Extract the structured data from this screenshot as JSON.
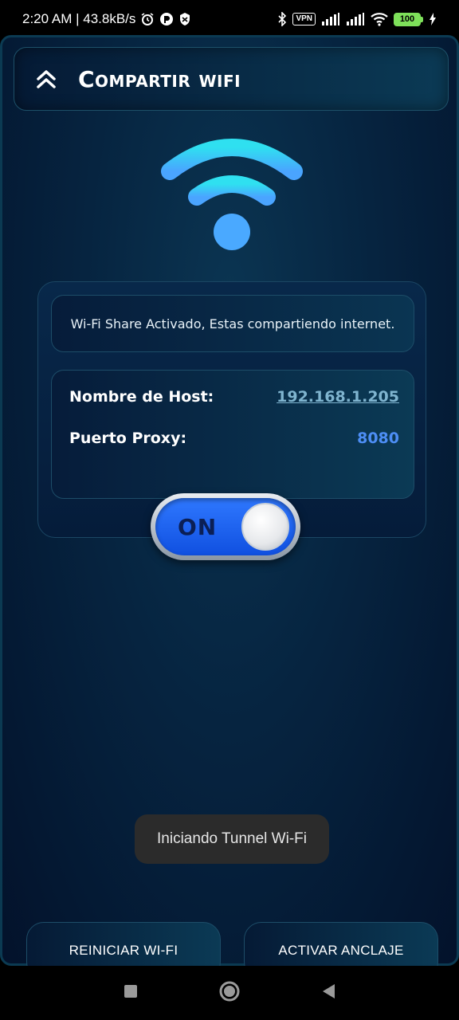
{
  "status_bar": {
    "time_speed": "2:20 AM | 43.8kB/s",
    "vpn_label": "VPN",
    "battery": "100"
  },
  "header": {
    "title": "Compartir wifi",
    "back_icon": "double-chevron-up-icon"
  },
  "wifi_logo": {
    "icon": "wifi-icon",
    "colors": {
      "top": "#2fd9f0",
      "bottom": "#4aa9ff"
    }
  },
  "status_message": "Wi-Fi Share Activado, Estas compartiendo internet.",
  "info": {
    "host_label": "Nombre de Host:",
    "host_value": "192.168.1.205",
    "port_label": "Puerto Proxy:",
    "port_value": "8080"
  },
  "toggle": {
    "label": "ON",
    "state": true,
    "accent": "#1f63f2"
  },
  "toast": "Iniciando Tunnel Wi-Fi",
  "buttons": {
    "restart": "REINICIAR WI-FI",
    "tether": "ACTIVAR ANCLAJE"
  },
  "nav": {
    "recents_icon": "square-icon",
    "home_icon": "circle-icon",
    "back_icon": "triangle-back-icon"
  }
}
